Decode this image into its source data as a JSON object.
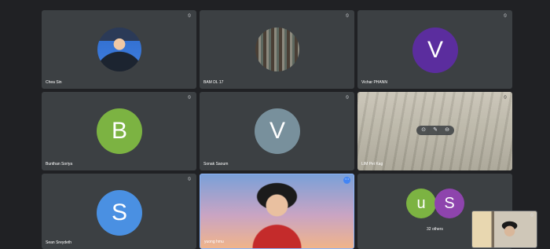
{
  "tiles": [
    {
      "name": "Chea Sin",
      "avatar_type": "photo",
      "mic_icon": "mic-off-icon"
    },
    {
      "name": "BAM DL 17",
      "avatar_type": "photo",
      "mic_icon": "mic-off-icon"
    },
    {
      "name": "Vichar PHANN",
      "avatar_type": "letter",
      "letter": "V",
      "color": "#5b2d9e",
      "mic_icon": "mic-off-icon"
    },
    {
      "name": "Bunthan Soriya",
      "avatar_type": "letter",
      "letter": "B",
      "color": "#7cb342",
      "mic_icon": "mic-off-icon"
    },
    {
      "name": "Sonak Saoum",
      "avatar_type": "letter",
      "letter": "V",
      "color": "#78909c",
      "mic_icon": "mic-off-icon"
    },
    {
      "name": "LIM Pei Kag",
      "avatar_type": "video",
      "mic_icon": "mic-off-icon"
    },
    {
      "name": "Sean Sreydeth",
      "avatar_type": "letter",
      "letter": "S",
      "color": "#4a90e2",
      "mic_icon": "mic-off-icon"
    },
    {
      "name": "yuong hmu",
      "avatar_type": "video"
    },
    {
      "name": "32 others",
      "avatars": [
        {
          "letter": "u",
          "color": "#7cb342"
        },
        {
          "letter": "S",
          "color": "#8e44ad"
        }
      ]
    }
  ],
  "controls": {
    "pin_icon": "pin-icon",
    "mute_icon": "mute-icon",
    "remove_icon": "remove-icon"
  },
  "more_options_icon": "more-options-icon"
}
